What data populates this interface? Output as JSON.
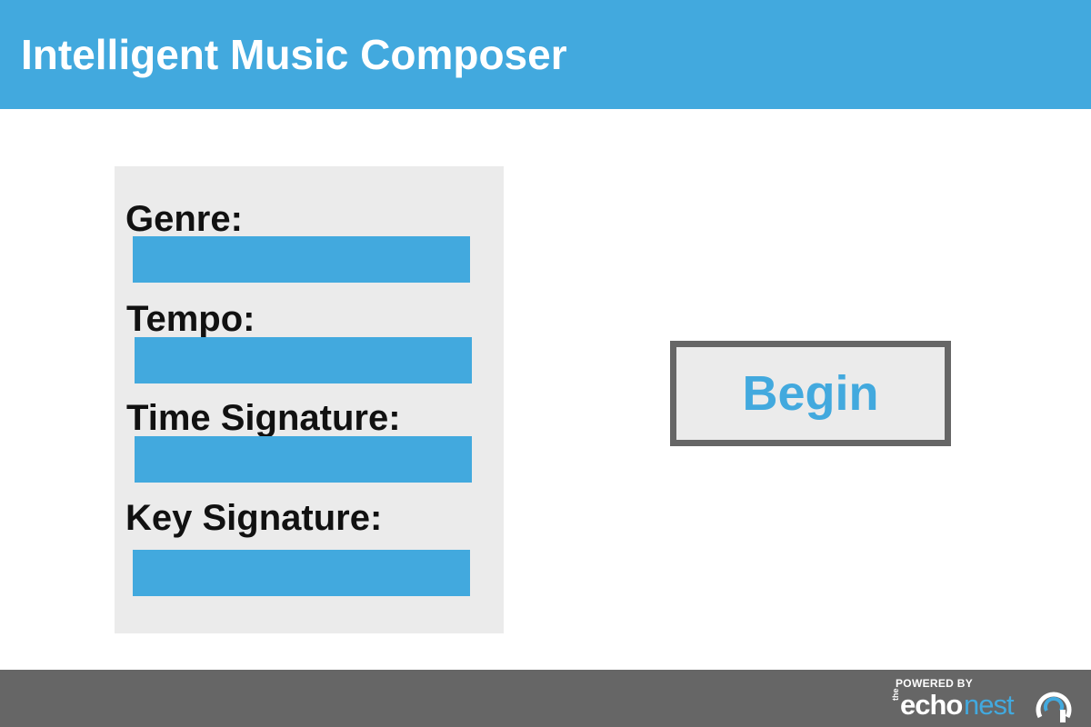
{
  "app": {
    "title": "Intelligent Music Composer"
  },
  "form": {
    "fields": [
      {
        "label": "Genre:",
        "value": "",
        "placeholder": ""
      },
      {
        "label": "Tempo:",
        "value": "",
        "placeholder": ""
      },
      {
        "label": "Time Signature:",
        "value": "",
        "placeholder": ""
      },
      {
        "label": "Key Signature:",
        "value": "",
        "placeholder": ""
      }
    ]
  },
  "actions": {
    "begin_label": "Begin"
  },
  "footer": {
    "powered_by": "POWERED BY",
    "brand_the": "the",
    "brand_echo": "echo",
    "brand_nest": "nest",
    "brand_icon": "echonest-arc-icon"
  },
  "colors": {
    "accent": "#42a9de",
    "panel": "#ebebeb",
    "footer": "#666666",
    "button_border": "#666666"
  }
}
